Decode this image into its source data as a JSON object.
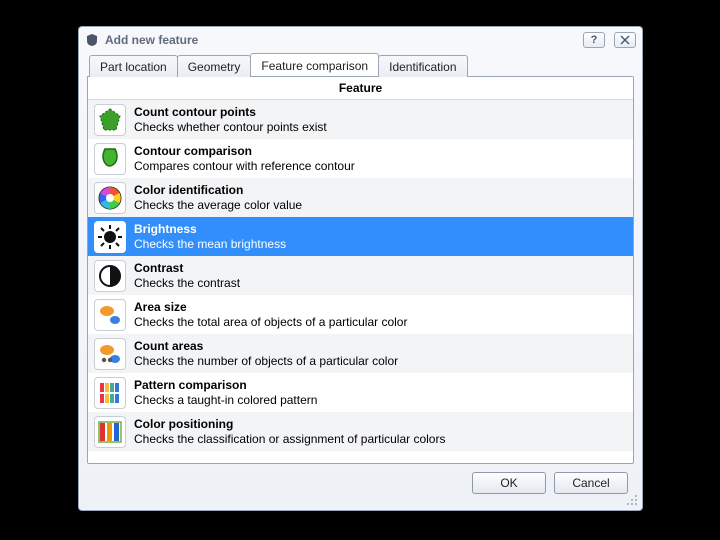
{
  "dialog": {
    "title": "Add new feature",
    "help_label": "?",
    "close_label": "✕"
  },
  "tabs": [
    {
      "label": "Part location"
    },
    {
      "label": "Geometry"
    },
    {
      "label": "Feature comparison"
    },
    {
      "label": "Identification"
    }
  ],
  "active_tab_index": 2,
  "column_header": "Feature",
  "features": [
    {
      "icon": "count-contour-points-icon",
      "title": "Count contour points",
      "desc": "Checks whether contour points exist",
      "selected": false
    },
    {
      "icon": "contour-comparison-icon",
      "title": "Contour comparison",
      "desc": "Compares contour with reference contour",
      "selected": false
    },
    {
      "icon": "color-identification-icon",
      "title": "Color identification",
      "desc": "Checks the average color value",
      "selected": false
    },
    {
      "icon": "brightness-icon",
      "title": "Brightness",
      "desc": "Checks the mean brightness",
      "selected": true
    },
    {
      "icon": "contrast-icon",
      "title": "Contrast",
      "desc": "Checks the contrast",
      "selected": false
    },
    {
      "icon": "area-size-icon",
      "title": "Area size",
      "desc": "Checks the total area of objects of a particular color",
      "selected": false
    },
    {
      "icon": "count-areas-icon",
      "title": "Count areas",
      "desc": "Checks the number of objects of a particular color",
      "selected": false
    },
    {
      "icon": "pattern-comparison-icon",
      "title": "Pattern comparison",
      "desc": "Checks a taught-in colored pattern",
      "selected": false
    },
    {
      "icon": "color-positioning-icon",
      "title": "Color positioning",
      "desc": "Checks the classification or assignment of particular colors",
      "selected": false
    }
  ],
  "buttons": {
    "ok": "OK",
    "cancel": "Cancel"
  }
}
